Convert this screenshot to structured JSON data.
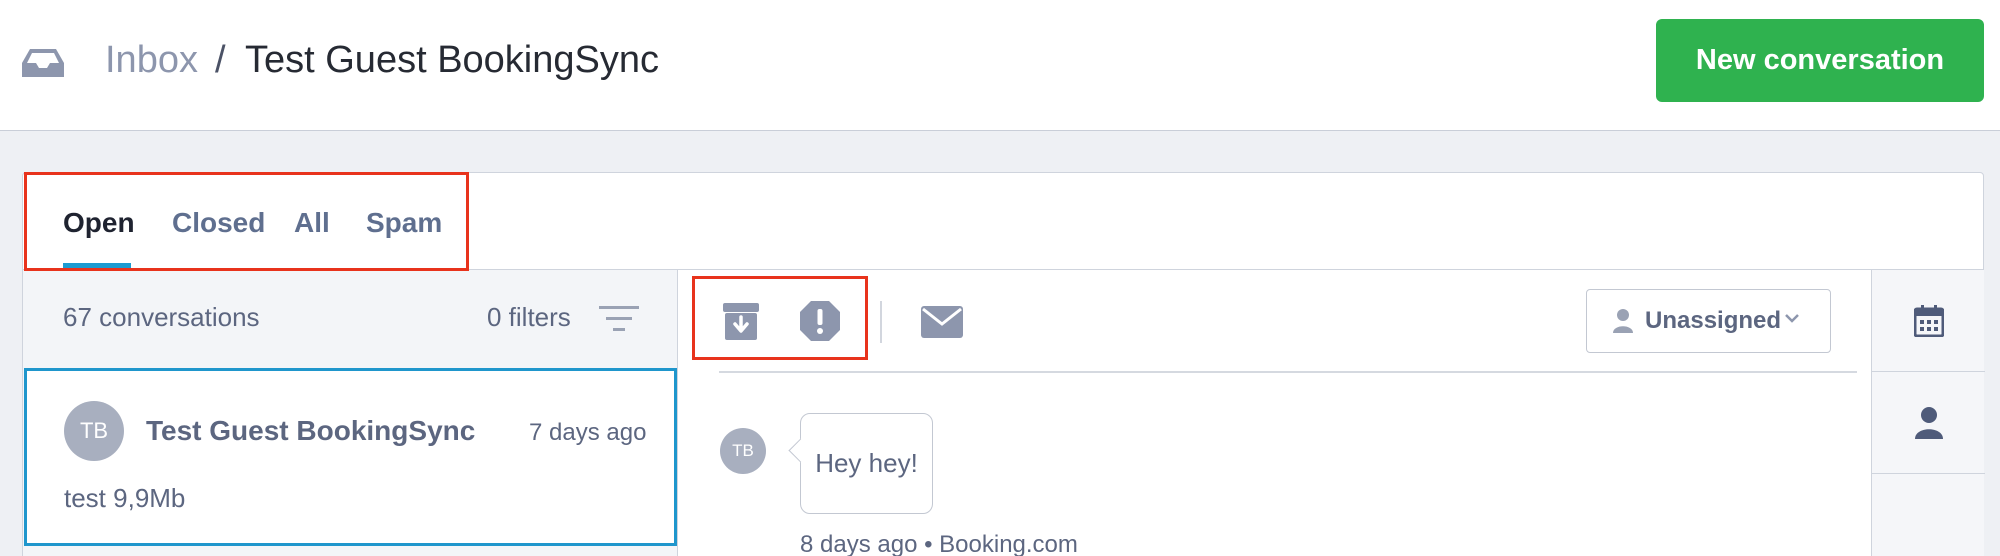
{
  "header": {
    "breadcrumb_root": "Inbox",
    "breadcrumb_separator": "/",
    "title": "Test Guest BookingSync",
    "new_conversation_label": "New conversation"
  },
  "tabs": [
    {
      "label": "Open",
      "active": true
    },
    {
      "label": "Closed",
      "active": false
    },
    {
      "label": "All",
      "active": false
    },
    {
      "label": "Spam",
      "active": false
    }
  ],
  "list": {
    "count_label": "67 conversations",
    "filters_label": "0 filters",
    "conversations": [
      {
        "initials": "TB",
        "name": "Test Guest BookingSync",
        "time": "7 days ago",
        "preview": "test 9,9Mb",
        "selected": true
      }
    ]
  },
  "detail": {
    "toolbar": {
      "archive_icon": "archive-icon",
      "spam_icon": "spam-alert-icon",
      "email_icon": "envelope-icon"
    },
    "assignee_label": "Unassigned",
    "messages": [
      {
        "initials": "TB",
        "text": "Hey hey!",
        "meta": "8 days ago • Booking.com"
      }
    ]
  },
  "sidebar": {
    "icons": [
      "calendar-icon",
      "user-icon"
    ]
  },
  "colors": {
    "primary_button": "#2fb24f",
    "active_tab_underline": "#1b9bd1",
    "highlight": "#e8331c",
    "selected_card_border": "#1f96cc"
  }
}
